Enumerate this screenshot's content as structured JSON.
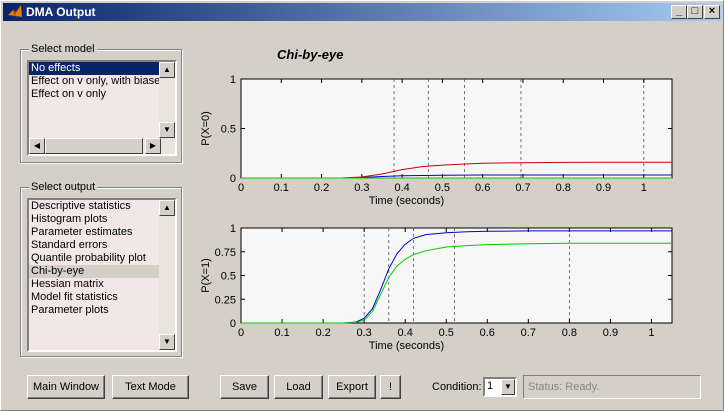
{
  "window": {
    "title": "DMA Output"
  },
  "select_model": {
    "label": "Select model",
    "items": [
      "No effects",
      "Effect on v only, with biase",
      "Effect on v only"
    ],
    "selected_index": 0
  },
  "select_output": {
    "label": "Select output",
    "items": [
      "Descriptive statistics",
      "Histogram plots",
      "Parameter estimates",
      "Standard errors",
      "Quantile probability plot",
      "Chi-by-eye",
      "Hessian matrix",
      "Model fit statistics",
      "Parameter plots"
    ],
    "selected_index": 5
  },
  "plot_title": "Chi-by-eye",
  "buttons": {
    "main_window": "Main Window",
    "text_mode": "Text Mode",
    "save": "Save",
    "load": "Load",
    "export": "Export",
    "bang": "!"
  },
  "condition": {
    "label": "Condition:",
    "value": "1"
  },
  "status": "Status: Ready.",
  "chart_data": [
    {
      "type": "line",
      "ylabel": "P(X=0)",
      "xlabel": "Time (seconds)",
      "xlim": [
        0,
        1.07
      ],
      "ylim": [
        0,
        1
      ],
      "x_ticks": [
        "0",
        "0.1",
        "0.2",
        "0.3",
        "0.4",
        "0.5",
        "0.6",
        "0.7",
        "0.8",
        "0.9",
        "1"
      ],
      "y_ticks": [
        "0",
        "0.5",
        "1"
      ],
      "vlines": [
        0.38,
        0.465,
        0.555,
        0.695,
        1.0
      ],
      "series": [
        {
          "color": "#cc0000",
          "x": [
            0,
            0.25,
            0.3,
            0.35,
            0.4,
            0.45,
            0.5,
            0.55,
            0.6,
            0.7,
            0.8,
            0.9,
            1.0,
            1.07
          ],
          "y": [
            0,
            0,
            0.01,
            0.04,
            0.085,
            0.115,
            0.13,
            0.14,
            0.148,
            0.155,
            0.158,
            0.16,
            0.16,
            0.16
          ]
        },
        {
          "color": "#0000cc",
          "x": [
            0,
            0.25,
            0.3,
            0.35,
            0.4,
            0.5,
            0.6,
            0.8,
            1.0,
            1.07
          ],
          "y": [
            0,
            0,
            0.005,
            0.015,
            0.022,
            0.028,
            0.03,
            0.03,
            0.03,
            0.03
          ]
        },
        {
          "color": "#00cc00",
          "x": [
            0,
            1.07
          ],
          "y": [
            0,
            0
          ]
        }
      ]
    },
    {
      "type": "line",
      "ylabel": "P(X=1)",
      "xlabel": "Time (seconds)",
      "xlim": [
        0,
        1.05
      ],
      "ylim": [
        0,
        1
      ],
      "x_ticks": [
        "0",
        "0.1",
        "0.2",
        "0.3",
        "0.4",
        "0.5",
        "0.6",
        "0.7",
        "0.8",
        "0.9",
        "1"
      ],
      "y_ticks": [
        "0",
        "0.25",
        "0.5",
        "0.75",
        "1"
      ],
      "vlines": [
        0.3,
        0.36,
        0.42,
        0.52,
        0.8
      ],
      "series": [
        {
          "color": "#0000cc",
          "x": [
            0,
            0.25,
            0.28,
            0.3,
            0.32,
            0.34,
            0.36,
            0.38,
            0.4,
            0.42,
            0.45,
            0.5,
            0.55,
            0.6,
            0.7,
            0.8,
            1.05
          ],
          "y": [
            0,
            0,
            0.01,
            0.05,
            0.15,
            0.35,
            0.57,
            0.73,
            0.83,
            0.89,
            0.93,
            0.95,
            0.96,
            0.965,
            0.97,
            0.97,
            0.97
          ]
        },
        {
          "color": "#00cc00",
          "x": [
            0,
            0.25,
            0.28,
            0.3,
            0.32,
            0.34,
            0.36,
            0.38,
            0.4,
            0.42,
            0.45,
            0.5,
            0.55,
            0.6,
            0.7,
            0.8,
            1.05
          ],
          "y": [
            0,
            0,
            0.005,
            0.03,
            0.12,
            0.3,
            0.48,
            0.6,
            0.67,
            0.72,
            0.76,
            0.8,
            0.815,
            0.825,
            0.835,
            0.84,
            0.84
          ]
        }
      ]
    }
  ]
}
